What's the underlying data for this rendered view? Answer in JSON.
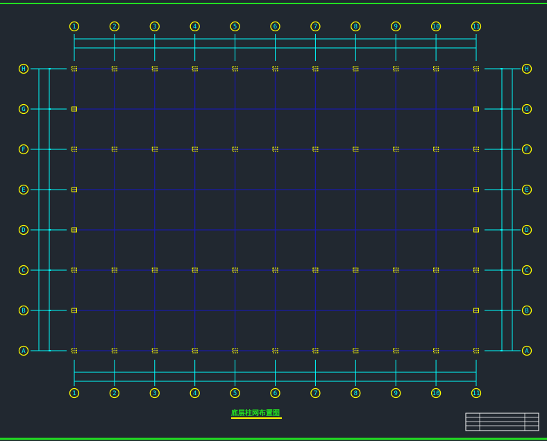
{
  "drawing": {
    "title": "底层柱网布置图",
    "x_axes": [
      "1",
      "2",
      "3",
      "4",
      "5",
      "6",
      "7",
      "8",
      "9",
      "10",
      "11"
    ],
    "y_axes": [
      "H",
      "G",
      "F",
      "E",
      "D",
      "C",
      "B",
      "A"
    ],
    "y_axis_labels_drawn": [
      "H",
      "G",
      "F",
      "E",
      "D",
      "C",
      "B",
      "A"
    ]
  },
  "colors": {
    "background": "#212830",
    "grid_line": "#1a1aa6",
    "dimension_line": "#00ffff",
    "bubble": "#ffff00",
    "column": "#ffff00",
    "frame": "#22e022",
    "title_underline": "#ffff00",
    "title_block": "#ffffff"
  }
}
